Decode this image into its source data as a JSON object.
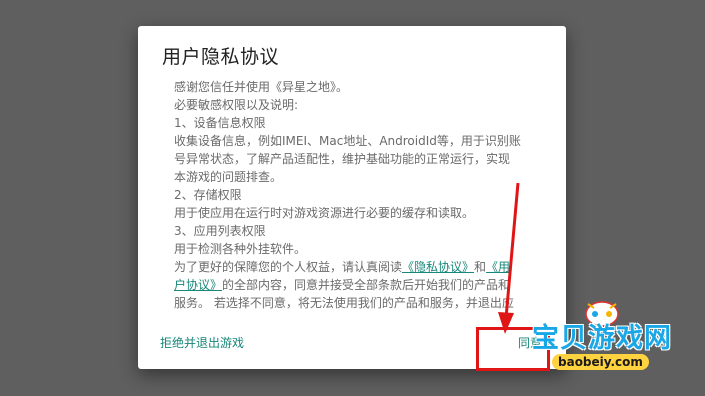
{
  "dialog": {
    "title": "用户隐私协议",
    "lines": [
      {
        "text": "感谢您信任并使用《异星之地》。"
      },
      {
        "text": "必要敏感权限以及说明:"
      },
      {
        "text": "1、设备信息权限"
      },
      {
        "text": "收集设备信息，例如IMEI、Mac地址、AndroidId等，用于识别账"
      },
      {
        "text": "号异常状态，了解产品适配性，维护基础功能的正常运行，实现"
      },
      {
        "text": "本游戏的问题排查。"
      },
      {
        "text": "2、存储权限"
      },
      {
        "text": "用于使应用在运行时对游戏资源进行必要的缓存和读取。"
      },
      {
        "text": "3、应用列表权限"
      },
      {
        "text": "用于检测各种外挂软件。"
      },
      {
        "pre": "为了更好的保障您的个人权益，请认真阅读",
        "link1": "《隐私协议》",
        "mid": "和",
        "link2": "《用"
      },
      {
        "link": "户协议》",
        "post": "的全部内容，同意并接受全部条款后开始我们的产品和"
      },
      {
        "text": "服务。 若选择不同意，将无法使用我们的产品和服务，并退出应"
      }
    ],
    "decline_label": "拒绝并退出游戏",
    "agree_label": "同意"
  },
  "watermark": {
    "name": "宝贝游戏网",
    "url": "baobeiy.com"
  },
  "colors": {
    "accent": "#18877a",
    "annotation": "#e01616",
    "overlay": "#5f5f5f"
  }
}
